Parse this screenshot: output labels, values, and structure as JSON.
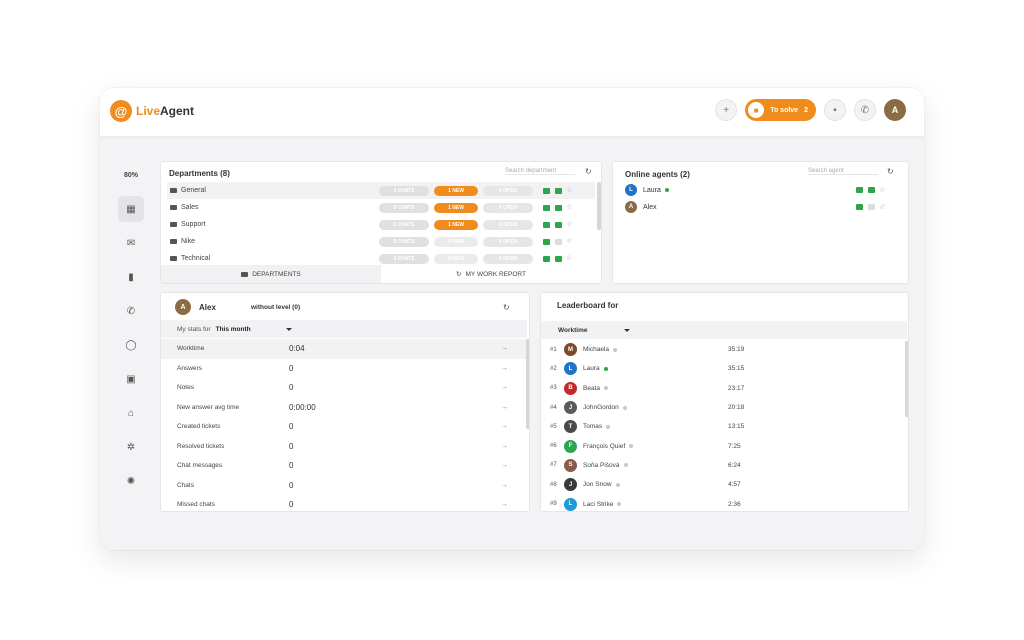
{
  "brand": {
    "live": "Live",
    "agent": "Agent",
    "mark": "@"
  },
  "topbar": {
    "to_solve_label": "To solve",
    "to_solve_count": "2",
    "avatar_initial": "A"
  },
  "sidebar": {
    "percent": "80%"
  },
  "departments": {
    "title": "Departments (8)",
    "search_placeholder": "Search department",
    "rows": [
      {
        "name": "General",
        "chats": "0 CHATS",
        "new": "1 NEW",
        "open": "0 OPEN",
        "new_active": true
      },
      {
        "name": "Sales",
        "chats": "0 CHATS",
        "new": "1 NEW",
        "open": "0 OPEN",
        "new_active": true
      },
      {
        "name": "Support",
        "chats": "0 CHATS",
        "new": "1 NEW",
        "open": "0 OPEN",
        "new_active": true
      },
      {
        "name": "Nike",
        "chats": "0 CHATS",
        "new": "0 NEW",
        "open": "0 OPEN",
        "new_active": false
      },
      {
        "name": "Technical",
        "chats": "0 CHATS",
        "new": "0 NEW",
        "open": "0 OPEN",
        "new_active": false
      }
    ],
    "tab_departments": "DEPARTMENTS",
    "tab_report": "MY WORK REPORT"
  },
  "online_agents": {
    "title": "Online agents (2)",
    "search_placeholder": "Search agent",
    "agents": [
      {
        "initial": "L",
        "name": "Laura",
        "color": "#1f73c9",
        "online": true
      },
      {
        "initial": "A",
        "name": "Alex",
        "color": "#8b6b43",
        "online": false
      }
    ]
  },
  "stats": {
    "agent_initial": "A",
    "agent_name": "Alex",
    "level": "without level (0)",
    "my_stats_for": "My stats for",
    "period": "This month",
    "rows": [
      {
        "label": "Worktime",
        "value": "0:04"
      },
      {
        "label": "Answers",
        "value": "0"
      },
      {
        "label": "Notes",
        "value": "0"
      },
      {
        "label": "New answer avg time",
        "value": "0:00:00"
      },
      {
        "label": "Created tickets",
        "value": "0"
      },
      {
        "label": "Resolved tickets",
        "value": "0"
      },
      {
        "label": "Chat messages",
        "value": "0"
      },
      {
        "label": "Chats",
        "value": "0"
      },
      {
        "label": "Missed chats",
        "value": "0"
      }
    ]
  },
  "leaderboard": {
    "title": "Leaderboard for",
    "metric": "Worktime",
    "rows": [
      {
        "rank": "#1",
        "initial": "M",
        "name": "Michaela",
        "time": "35:19",
        "color": "#7a4a2a",
        "online": false
      },
      {
        "rank": "#2",
        "initial": "L",
        "name": "Laura",
        "time": "35:15",
        "color": "#1f73c9",
        "online": true
      },
      {
        "rank": "#3",
        "initial": "B",
        "name": "Beata",
        "time": "23:17",
        "color": "#c62828",
        "online": false
      },
      {
        "rank": "#4",
        "initial": "J",
        "name": "JohnGordon",
        "time": "20:18",
        "color": "#5a5a5a",
        "online": false
      },
      {
        "rank": "#5",
        "initial": "T",
        "name": "Tomas",
        "time": "13:15",
        "color": "#4a4a4a",
        "online": false
      },
      {
        "rank": "#6",
        "initial": "F",
        "name": "François Quief",
        "time": "7:25",
        "color": "#2ea44f",
        "online": false
      },
      {
        "rank": "#7",
        "initial": "S",
        "name": "Soňa Pišová",
        "time": "6:24",
        "color": "#8a5a4a",
        "online": false
      },
      {
        "rank": "#8",
        "initial": "J",
        "name": "Jon Snow",
        "time": "4:57",
        "color": "#3a3a3a",
        "online": false
      },
      {
        "rank": "#9",
        "initial": "L",
        "name": "Laci Strike",
        "time": "2:36",
        "color": "#1f9ad6",
        "online": false
      }
    ]
  }
}
